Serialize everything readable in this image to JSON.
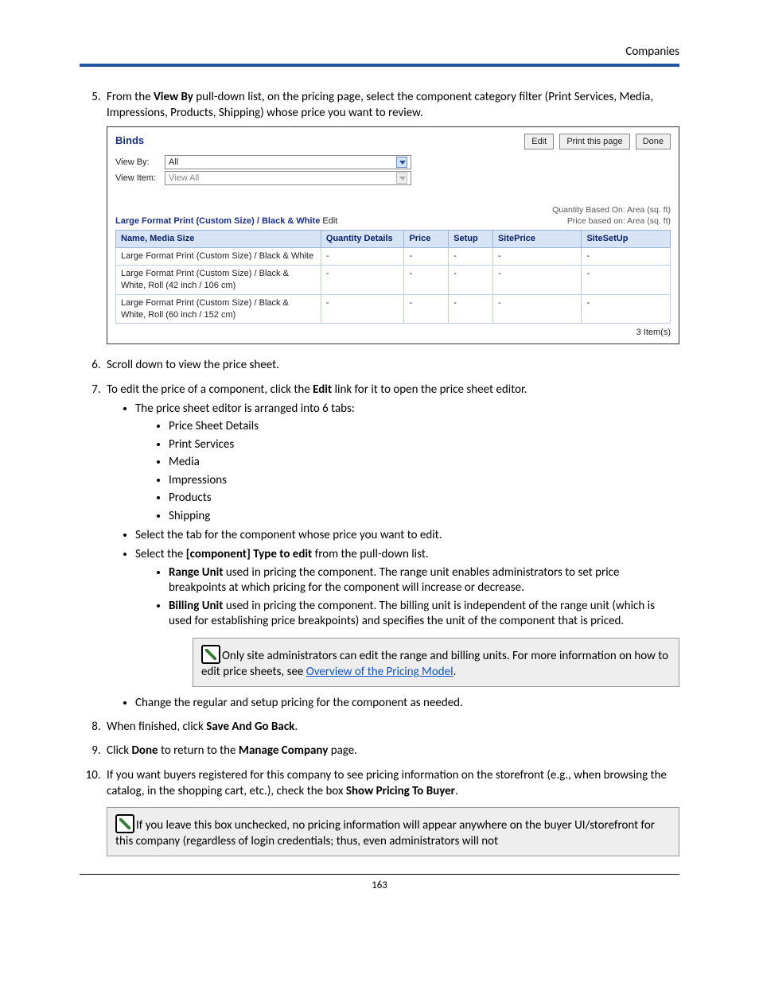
{
  "header": {
    "section": "Companies"
  },
  "footer": {
    "page": "163"
  },
  "steps": {
    "s5_a": "From the ",
    "s5_b": "View By",
    "s5_c": " pull-down list, on the pricing page, select the component category filter (Print Services, Media, Impressions, Products, Shipping) whose price you want to review.",
    "s6": "Scroll down to view the price sheet.",
    "s7_a": "To edit the price of a component, click the ",
    "s7_b": "Edit",
    "s7_c": " link for it to open the price sheet editor.",
    "s7_sub_intro": "The price sheet editor is arranged into 6 tabs:",
    "tab1": "Price Sheet Details",
    "tab2": "Print Services",
    "tab3": "Media",
    "tab4": "Impressions",
    "tab5": "Products",
    "tab6": "Shipping",
    "s7_sub_sel": "Select the tab for the component whose price you want to edit.",
    "s7_type_a": "Select the ",
    "s7_type_b": "[component] Type to edit",
    "s7_type_c": " from the pull-down list.",
    "range_b": "Range Unit",
    "range_t": " used in pricing the component. The range unit enables administrators to set price breakpoints at which pricing for the component will increase or decrease.",
    "bill_b": "Billing Unit",
    "bill_t": " used in pricing the component. The billing unit is independent of the range unit (which is used for establishing price breakpoints) and specifies the unit of the component that is priced.",
    "note1_a": "Only site administrators can edit the range and billing units. For more information on how to edit price sheets, see ",
    "note1_link": "Overview of the Pricing Model",
    "note1_b": ".",
    "s7_change": "Change the regular and setup pricing for the component as needed.",
    "s8_a": "When finished, click ",
    "s8_b": "Save And Go Back",
    "s8_c": ".",
    "s9_a": "Click ",
    "s9_b": "Done",
    "s9_c": " to return to the ",
    "s9_d": "Manage Company",
    "s9_e": " page.",
    "s10_a": "If you want buyers registered for this company to see pricing information on the storefront (e.g., when browsing the catalog, in the shopping cart, etc.), check the box ",
    "s10_b": "Show Pricing To Buyer",
    "s10_c": ".",
    "note2": "If you leave this box unchecked, no pricing information will appear anywhere on the buyer UI/storefront for this company (regardless of login credentials; thus, even administrators will not"
  },
  "shot": {
    "title": "Binds",
    "buttons": {
      "edit": "Edit",
      "print": "Print this page",
      "done": "Done"
    },
    "viewby_label": "View By:",
    "viewby_value": "All",
    "viewitem_label": "View Item:",
    "viewitem_value": "View All",
    "section_title": "Large Format Print (Custom Size) / Black & White",
    "section_edit": "Edit",
    "qty_based": "Quantity Based On:   Area (sq. ft)",
    "price_based": "Price based on:   Area (sq. ft)",
    "cols": {
      "c1": "Name, Media Size",
      "c2": "Quantity Details",
      "c3": "Price",
      "c4": "Setup",
      "c5": "SitePrice",
      "c6": "SiteSetUp"
    },
    "rows": {
      "r1": "Large Format Print (Custom Size) / Black & White",
      "r2": "Large Format Print (Custom Size) / Black & White, Roll (42 inch / 106 cm)",
      "r3": "Large Format Print (Custom Size) / Black & White, Roll (60 inch / 152 cm)",
      "dash": "-"
    },
    "itemcount": "3 Item(s)"
  }
}
